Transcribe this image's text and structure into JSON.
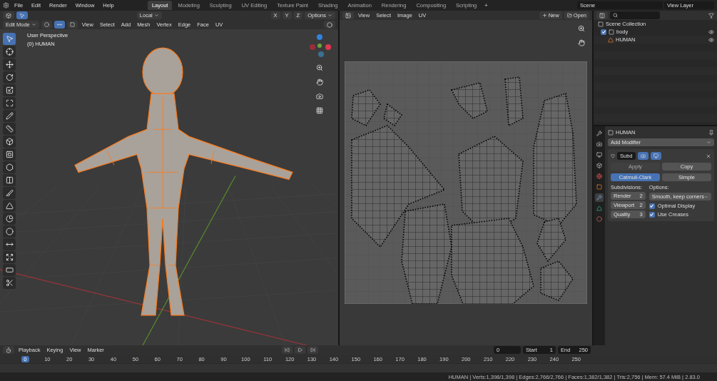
{
  "menu": [
    "File",
    "Edit",
    "Render",
    "Window",
    "Help"
  ],
  "workspaces": [
    {
      "label": "Layout",
      "selected": true
    },
    {
      "label": "Modeling",
      "selected": false
    },
    {
      "label": "Sculpting",
      "selected": false
    },
    {
      "label": "UV Editing",
      "selected": false
    },
    {
      "label": "Texture Paint",
      "selected": false
    },
    {
      "label": "Shading",
      "selected": false
    },
    {
      "label": "Animation",
      "selected": false
    },
    {
      "label": "Rendering",
      "selected": false
    },
    {
      "label": "Compositing",
      "selected": false
    },
    {
      "label": "Scripting",
      "selected": false
    }
  ],
  "add_workspace": "+",
  "scene": "Scene",
  "view_layer": "View Layer",
  "viewport": {
    "orientation": "Local",
    "axes": [
      "X",
      "Y",
      "Z"
    ],
    "options": "Options",
    "mode": "Edit Mode",
    "select_modes": [
      {
        "kind": "vertex",
        "selected": false
      },
      {
        "kind": "edge",
        "selected": true
      },
      {
        "kind": "face",
        "selected": false
      }
    ],
    "menus": [
      "View",
      "Select",
      "Add",
      "Mesh",
      "Vertex",
      "Edge",
      "Face",
      "UV"
    ],
    "overlay": [
      "User Perspective",
      "(0) HUMAN"
    ],
    "tools": [
      {
        "kind": "select",
        "selected": true
      },
      {
        "kind": "cursor",
        "selected": false
      },
      {
        "kind": "move",
        "selected": false
      },
      {
        "kind": "rotate",
        "selected": false
      },
      {
        "kind": "scale",
        "selected": false
      },
      {
        "kind": "transform",
        "selected": false
      },
      {
        "kind": "annotate",
        "selected": false
      },
      {
        "kind": "measure",
        "selected": false
      },
      {
        "kind": "extrude",
        "selected": false
      },
      {
        "kind": "inset",
        "selected": false
      },
      {
        "kind": "bevel",
        "selected": false
      },
      {
        "kind": "loopcut",
        "selected": false
      },
      {
        "kind": "knife",
        "selected": false
      },
      {
        "kind": "polybuild",
        "selected": false
      },
      {
        "kind": "spin",
        "selected": false
      },
      {
        "kind": "smooth",
        "selected": false
      },
      {
        "kind": "slide",
        "selected": false
      },
      {
        "kind": "shrink",
        "selected": false
      },
      {
        "kind": "shear",
        "selected": false
      },
      {
        "kind": "rip",
        "selected": false
      }
    ]
  },
  "uv_editor": {
    "menus": [
      "View",
      "Select",
      "Image",
      "UV"
    ],
    "new": "New",
    "open": "Open"
  },
  "outliner": {
    "root": "Scene Collection",
    "children": [
      {
        "label": "body",
        "checked": true,
        "children": [
          {
            "label": "HUMAN"
          }
        ]
      }
    ]
  },
  "properties": {
    "object": "HUMAN",
    "add_modifier": "Add Modifier",
    "modifier": {
      "name": "Subd",
      "expanded": true,
      "apply": "Apply",
      "apply_disabled": true,
      "copy": "Copy",
      "types": [
        {
          "label": "Catmull-Clark",
          "selected": true
        },
        {
          "label": "Simple",
          "selected": false
        }
      ],
      "subdivisions_label": "Subdivisions:",
      "fields": [
        {
          "label": "Render",
          "value": "2"
        },
        {
          "label": "Viewport",
          "value": "2"
        },
        {
          "label": "Quality",
          "value": "3"
        }
      ],
      "options_label": "Options:",
      "uv_smooth": "Smooth, keep corners",
      "checks": [
        {
          "label": "Optimal Display",
          "checked": true
        },
        {
          "label": "Use Creases",
          "checked": true
        }
      ]
    }
  },
  "timeline": {
    "menus": [
      "Playback",
      "Keying",
      "View",
      "Marker"
    ],
    "current": "0",
    "start_label": "Start",
    "start": "1",
    "end_label": "End",
    "end": "250",
    "frames": [
      {
        "label": "0",
        "selected": true
      },
      {
        "label": "10",
        "selected": false
      },
      {
        "label": "20",
        "selected": false
      },
      {
        "label": "30",
        "selected": false
      },
      {
        "label": "40",
        "selected": false
      },
      {
        "label": "50",
        "selected": false
      },
      {
        "label": "60",
        "selected": false
      },
      {
        "label": "70",
        "selected": false
      },
      {
        "label": "80",
        "selected": false
      },
      {
        "label": "90",
        "selected": false
      },
      {
        "label": "100",
        "selected": false
      },
      {
        "label": "110",
        "selected": false
      },
      {
        "label": "120",
        "selected": false
      },
      {
        "label": "130",
        "selected": false
      },
      {
        "label": "140",
        "selected": false
      },
      {
        "label": "150",
        "selected": false
      },
      {
        "label": "160",
        "selected": false
      },
      {
        "label": "170",
        "selected": false
      },
      {
        "label": "180",
        "selected": false
      },
      {
        "label": "190",
        "selected": false
      },
      {
        "label": "200",
        "selected": false
      },
      {
        "label": "210",
        "selected": false
      },
      {
        "label": "220",
        "selected": false
      },
      {
        "label": "230",
        "selected": false
      },
      {
        "label": "240",
        "selected": false
      },
      {
        "label": "250",
        "selected": false
      }
    ]
  },
  "status_bar": "HUMAN | Verts:1,398/1,398 | Edges:2,766/2,766 | Faces:1,382/1,382 | Tris:2,756 | Mem: 57.4 MiB | 2.83.0"
}
